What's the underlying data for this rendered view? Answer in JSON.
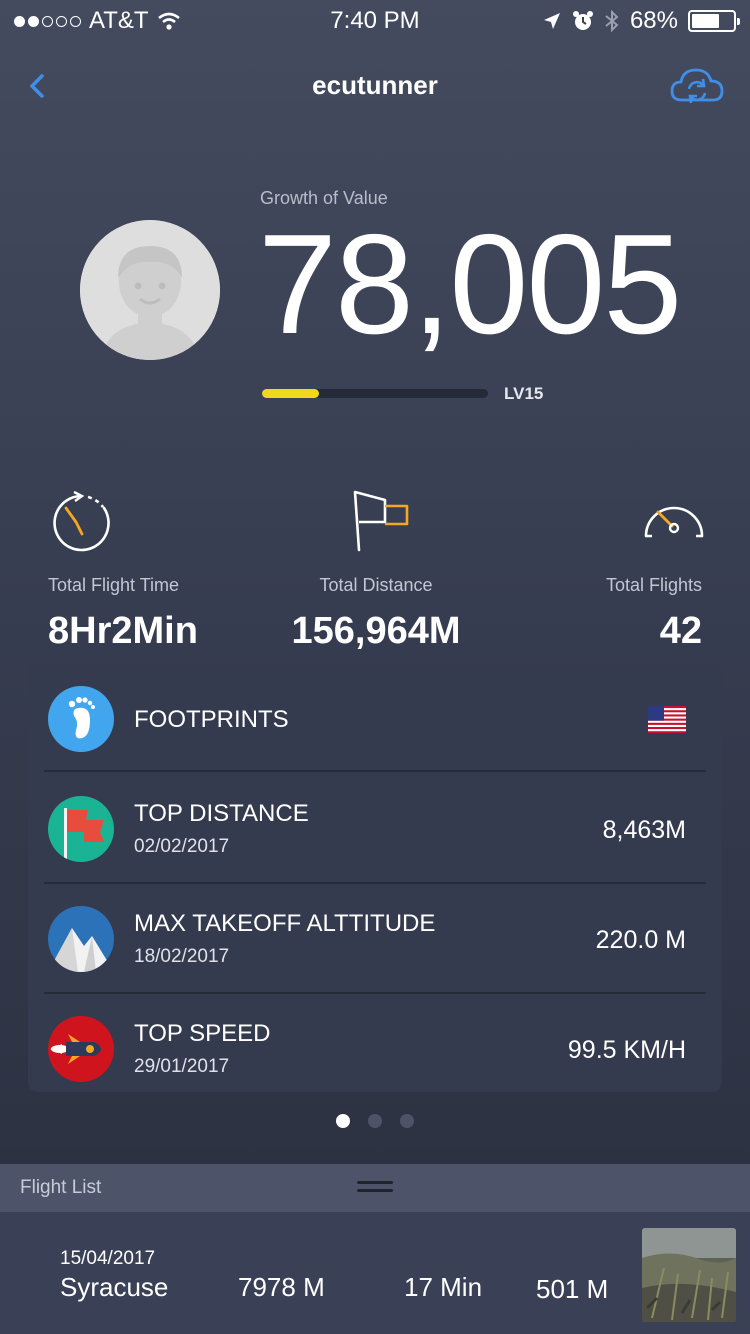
{
  "status_bar": {
    "carrier": "AT&T",
    "time": "7:40 PM",
    "battery": "68%",
    "battery_level": 0.68
  },
  "nav": {
    "title": "ecutunner"
  },
  "profile": {
    "growth_label": "Growth of Value",
    "growth_value": "78,005",
    "level_label": "LV15",
    "level_progress": 0.25
  },
  "stats": [
    {
      "label": "Total Flight Time",
      "value": "8Hr2Min",
      "icon": "stopwatch-icon"
    },
    {
      "label": "Total Distance",
      "value": "156,964M",
      "icon": "flag-icon"
    },
    {
      "label": "Total Flights",
      "value": "42",
      "icon": "speedometer-icon"
    }
  ],
  "records": {
    "footprints_label": "FOOTPRINTS",
    "items": [
      {
        "title": "TOP DISTANCE",
        "date": "02/02/2017",
        "value": "8,463M",
        "icon": "red-flag-icon"
      },
      {
        "title": "MAX TAKEOFF ALTTITUDE",
        "date": "18/02/2017",
        "value": "220.0 M",
        "icon": "mountain-icon"
      },
      {
        "title": "TOP SPEED",
        "date": "29/01/2017",
        "value": "99.5 KM/H",
        "icon": "rocket-icon"
      }
    ]
  },
  "flight_list": {
    "header": "Flight List",
    "rows": [
      {
        "date": "15/04/2017",
        "location": "Syracuse",
        "distance": "7978 M",
        "duration": "17 Min",
        "altitude": "501 M"
      }
    ]
  },
  "colors": {
    "accent_blue": "#3f8fe8",
    "level_yellow": "#f0d81e",
    "icon_orange": "#f5a623"
  }
}
